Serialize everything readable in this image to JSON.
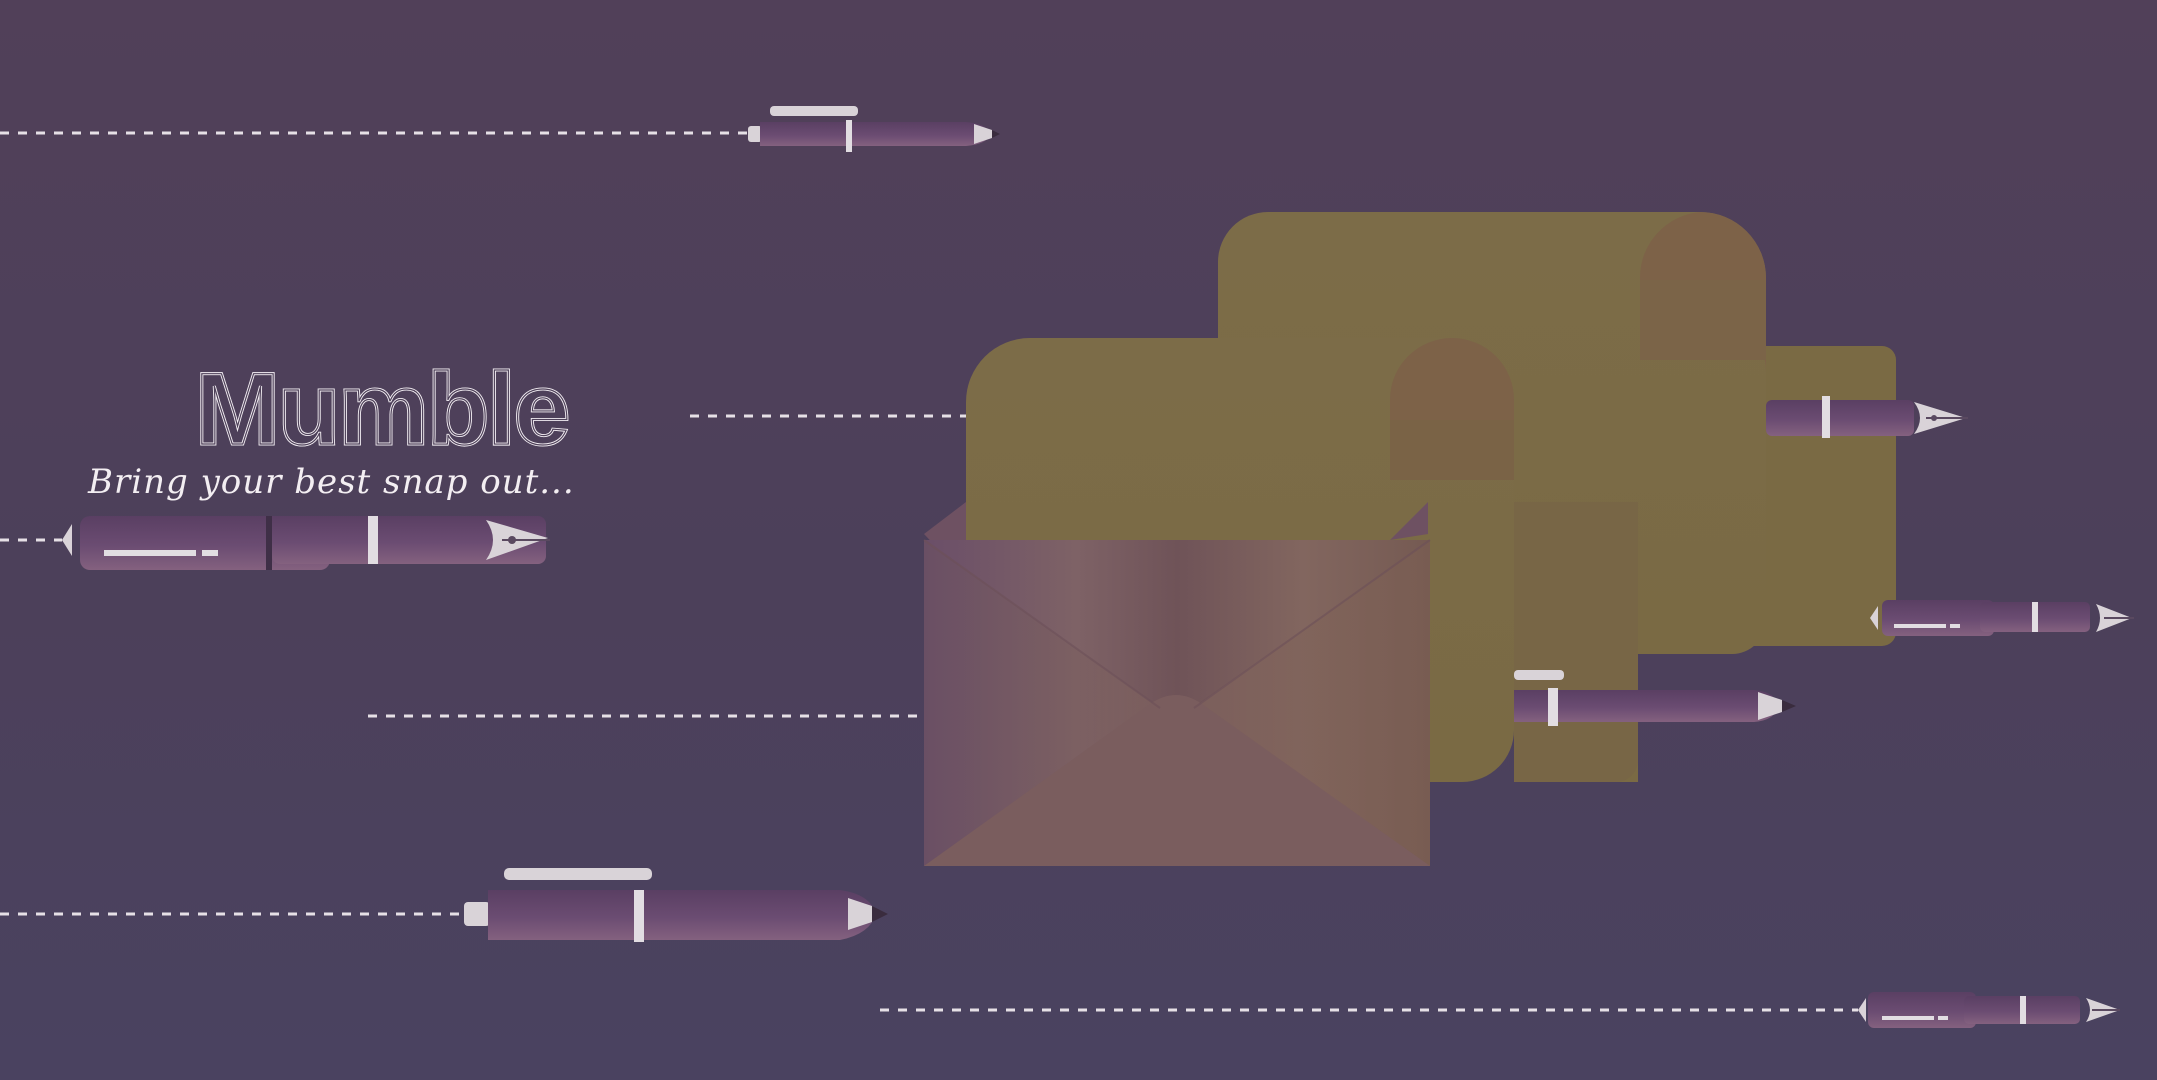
{
  "app": {
    "title": "Mumble",
    "tagline": "Bring your best snap out..."
  },
  "colors": {
    "background": "#4d405a",
    "pen_body": "#6b4c72",
    "pen_highlight": "#8a6a8e",
    "pen_metal": "#d9d3d8",
    "dash_line": "#e6e0e6",
    "letter_paper": "#7a6a46",
    "envelope": "#7d5f62",
    "logo_stroke": "#f4eff4"
  },
  "icons": {
    "logo": "mumble-wordmark",
    "envelope": "open-envelope-icon",
    "letter": "rolled-letter-icon",
    "pens": [
      "ballpoint-pen-icon",
      "fountain-pen-icon"
    ]
  }
}
